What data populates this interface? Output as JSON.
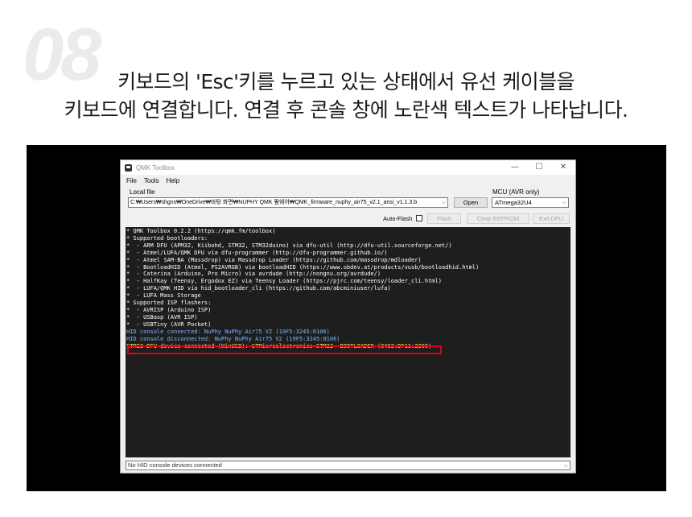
{
  "step": {
    "number": "08"
  },
  "instruction": {
    "line1": "키보드의 'Esc'키를 누르고 있는 상태에서 유선 케이블을",
    "line2": "키보드에 연결합니다. 연결 후 콘솔 창에 노란색 텍스트가 나타납니다."
  },
  "window": {
    "title": "QMK Toolbox",
    "controls": {
      "minimize": "—",
      "maximize": "☐",
      "close": "✕"
    },
    "menu": [
      "File",
      "Tools",
      "Help"
    ],
    "local_file_label": "Local file",
    "local_file_value": "C:₩Users₩shgns₩OneDrive₩바탕 화면₩NUPHY QMK 펌웨어₩QMK_firmware_nuphy_air75_v2.1_ansi_v1.1.3.b",
    "open_label": "Open",
    "mcu_label": "MCU (AVR only)",
    "mcu_value": "ATmega32U4",
    "auto_flash_label": "Auto-Flash",
    "auto_flash_checked": false,
    "flash_label": "Flash",
    "clear_eeprom_label": "Clear EEPROM",
    "exit_dfu_label": "Exit DFU",
    "status": "No HID console devices connected"
  },
  "console": {
    "lines": [
      {
        "type": "info",
        "text": "* QMK Toolbox 0.2.2 (https://qmk.fm/toolbox)"
      },
      {
        "type": "info",
        "text": "* Supported bootloaders:"
      },
      {
        "type": "info",
        "text": "*  - ARM DFU (APM32, Kiibohd, STM32, STM32duino) via dfu-util (http://dfu-util.sourceforge.net/)"
      },
      {
        "type": "info",
        "text": "*  - Atmel/LUFA/QMK DFU via dfu-programmer (http://dfu-programmer.github.io/)"
      },
      {
        "type": "info",
        "text": "*  - Atmel SAM-BA (Massdrop) via Massdrop Loader (https://github.com/massdrop/mdloader)"
      },
      {
        "type": "info",
        "text": "*  - BootloadHID (Atmel, PS2AVRGB) via bootloadHID (https://www.obdev.at/products/vusb/bootloadhid.html)"
      },
      {
        "type": "info",
        "text": "*  - Caterina (Arduino, Pro Micro) via avrdude (http://nongnu.org/avrdude/)"
      },
      {
        "type": "info",
        "text": "*  - HalfKay (Teensy, Ergodox EZ) via Teensy Loader (https://pjrc.com/teensy/loader_cli.html)"
      },
      {
        "type": "info",
        "text": "*  - LUFA/QMK HID via hid_bootloader_cli (https://github.com/abcminiuser/lufa)"
      },
      {
        "type": "info",
        "text": "*  - LUFA Mass Storage"
      },
      {
        "type": "info",
        "text": "* Supported ISP flashers:"
      },
      {
        "type": "info",
        "text": "*  - AVRISP (Arduino ISP)"
      },
      {
        "type": "info",
        "text": "*  - USBasp (AVR ISP)"
      },
      {
        "type": "info",
        "text": "*  - USBTiny (AVR Pocket)"
      },
      {
        "type": "hid",
        "text": "HID console connected: NuPhy NuPhy Air75 V2 (19F5:3245:0106)"
      },
      {
        "type": "hid",
        "text": "HID console disconnected: NuPhy NuPhy Air75 V2 (19F5:3245:0106)"
      },
      {
        "type": "device",
        "text": "STM32 DFU device connected (WinUSB): STMicroelectronics STM32  BOOTLOADER (0483:DF11:2200)"
      }
    ]
  },
  "colors": {
    "console_bg": "#1e1e1e",
    "console_info": "#ffffff",
    "console_hid": "#7fb7ff",
    "console_device": "#ffff33",
    "highlight": "#e0001a",
    "screen_bg": "#000000"
  }
}
